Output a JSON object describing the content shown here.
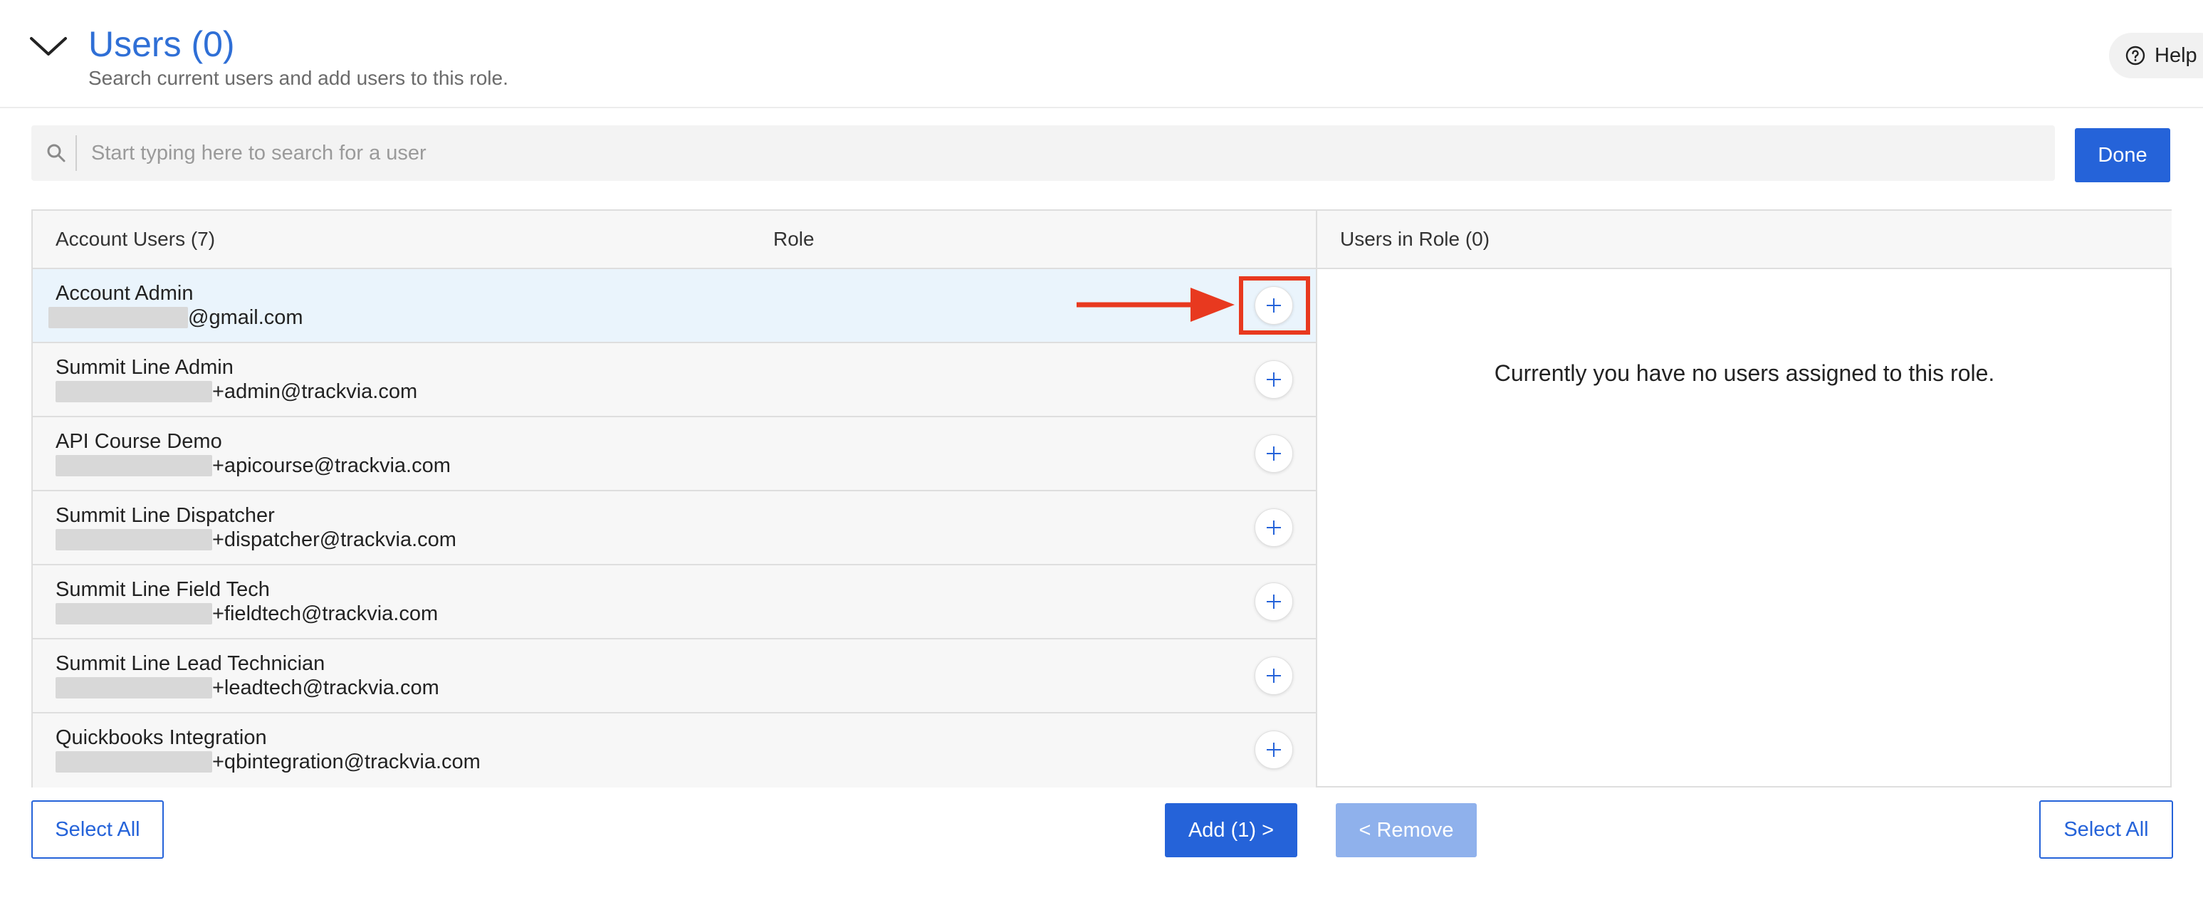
{
  "header": {
    "title": "Users (0)",
    "subtitle": "Search current users and add users to this role.",
    "help_label": "Help",
    "collapse_icon": "chevron-down-icon"
  },
  "search": {
    "placeholder": "Start typing here to search for a user",
    "value": ""
  },
  "done_label": "Done",
  "left_table": {
    "header_users": "Account Users (7)",
    "header_role": "Role",
    "rows": [
      {
        "name": "Account Admin",
        "email": "@gmail.com",
        "selected": true
      },
      {
        "name": "Summit Line Admin",
        "email": "+admin@trackvia.com"
      },
      {
        "name": "API Course Demo",
        "email": "+apicourse@trackvia.com"
      },
      {
        "name": "Summit Line Dispatcher",
        "email": "+dispatcher@trackvia.com"
      },
      {
        "name": "Summit Line Field Tech",
        "email": "+fieldtech@trackvia.com"
      },
      {
        "name": "Summit Line Lead Technician",
        "email": "+leadtech@trackvia.com"
      },
      {
        "name": "Quickbooks Integration",
        "email": "+qbintegration@trackvia.com"
      }
    ]
  },
  "right_table": {
    "header": "Users in Role (0)",
    "empty_message": "Currently you have no users assigned to this role."
  },
  "footer": {
    "select_all_left": "Select All",
    "add_label": "Add (1) >",
    "remove_label": "< Remove",
    "select_all_right": "Select All"
  },
  "colors": {
    "accent": "#2563d9",
    "title": "#2f6fd6",
    "annotation": "#e8391f",
    "selected_row": "#eaf4fc"
  }
}
